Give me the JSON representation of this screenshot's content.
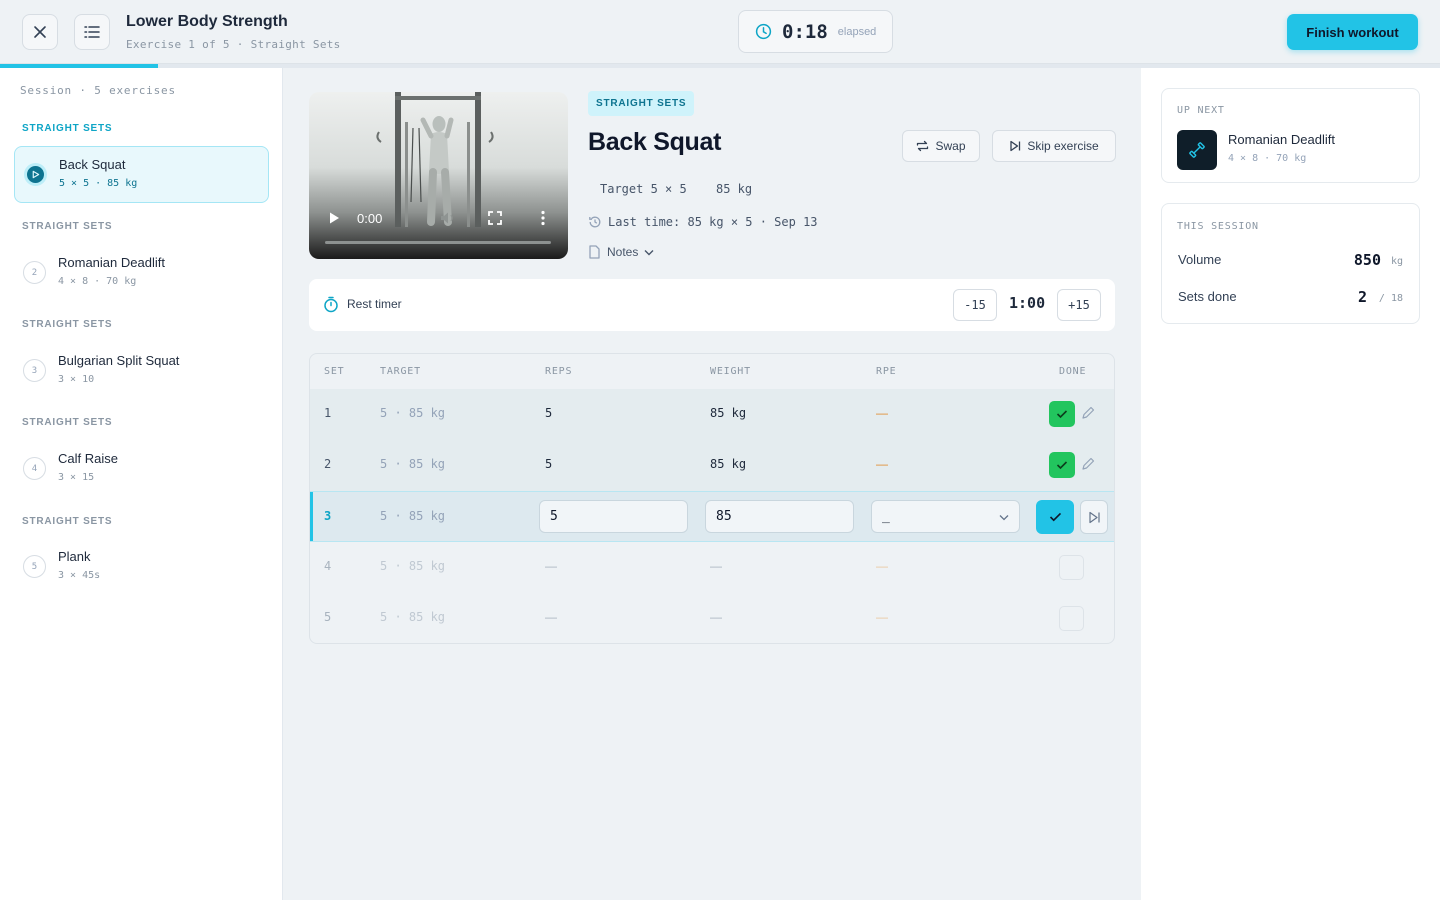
{
  "header": {
    "title": "Lower Body Strength",
    "subtitle": "Exercise 1 of 5 · Straight Sets",
    "elapsed_time": "0:18",
    "elapsed_label": "elapsed",
    "finish_label": "Finish workout",
    "progress_fraction": 0.11,
    "accent_color": "#22c3e6"
  },
  "sidebar": {
    "heading": "Session · 5 exercises",
    "items": [
      {
        "section": "STRAIGHT SETS",
        "number": "1",
        "name": "Back Squat",
        "detail": "5 × 5 · 85 kg",
        "active": true
      },
      {
        "section": "STRAIGHT SETS",
        "number": "2",
        "name": "Romanian Deadlift",
        "detail": "4 × 8 · 70 kg"
      },
      {
        "section": "STRAIGHT SETS",
        "number": "3",
        "name": "Bulgarian Split Squat",
        "detail": "3 × 10"
      },
      {
        "section": "STRAIGHT SETS",
        "number": "4",
        "name": "Calf Raise",
        "detail": "3 × 15"
      },
      {
        "section": "STRAIGHT SETS",
        "number": "5",
        "name": "Plank",
        "detail": "3 × 45s"
      }
    ]
  },
  "exercise": {
    "chip": "STRAIGHT SETS",
    "title": "Back Squat",
    "swap_label": "Swap",
    "skip_label": "Skip exercise",
    "target": "Target 5 × 5",
    "target_weight": "85 kg",
    "last_time": "Last time: 85 kg × 5 · Sep 13",
    "notes_label": "Notes",
    "video_time": "0:00"
  },
  "rest_timer": {
    "label": "Rest timer",
    "minus": "-15",
    "time": "1:00",
    "plus": "+15"
  },
  "sets_table": {
    "columns": [
      "SET",
      "TARGET",
      "REPS",
      "WEIGHT",
      "RPE",
      "DONE"
    ],
    "rows": [
      {
        "set": "1",
        "target": "5 · 85 kg",
        "reps": "5",
        "weight": "85 kg",
        "rpe": "—",
        "status": "done"
      },
      {
        "set": "2",
        "target": "5 · 85 kg",
        "reps": "5",
        "weight": "85 kg",
        "rpe": "—",
        "status": "done"
      },
      {
        "set": "3",
        "target": "5 · 85 kg",
        "reps": "5",
        "weight": "85",
        "rpe": "_",
        "status": "current"
      },
      {
        "set": "4",
        "target": "5 · 85 kg",
        "reps": "—",
        "weight": "—",
        "rpe": "—",
        "status": "pending"
      },
      {
        "set": "5",
        "target": "5 · 85 kg",
        "reps": "—",
        "weight": "—",
        "rpe": "—",
        "status": "pending"
      }
    ]
  },
  "up_next": {
    "label": "UP NEXT",
    "name": "Romanian Deadlift",
    "detail": "4 × 8 · 70 kg"
  },
  "session_stats": {
    "label": "THIS SESSION",
    "volume_label": "Volume",
    "volume_value": "850",
    "volume_unit": "kg",
    "sets_label": "Sets done",
    "sets_value": "2",
    "sets_total": "/ 18"
  }
}
